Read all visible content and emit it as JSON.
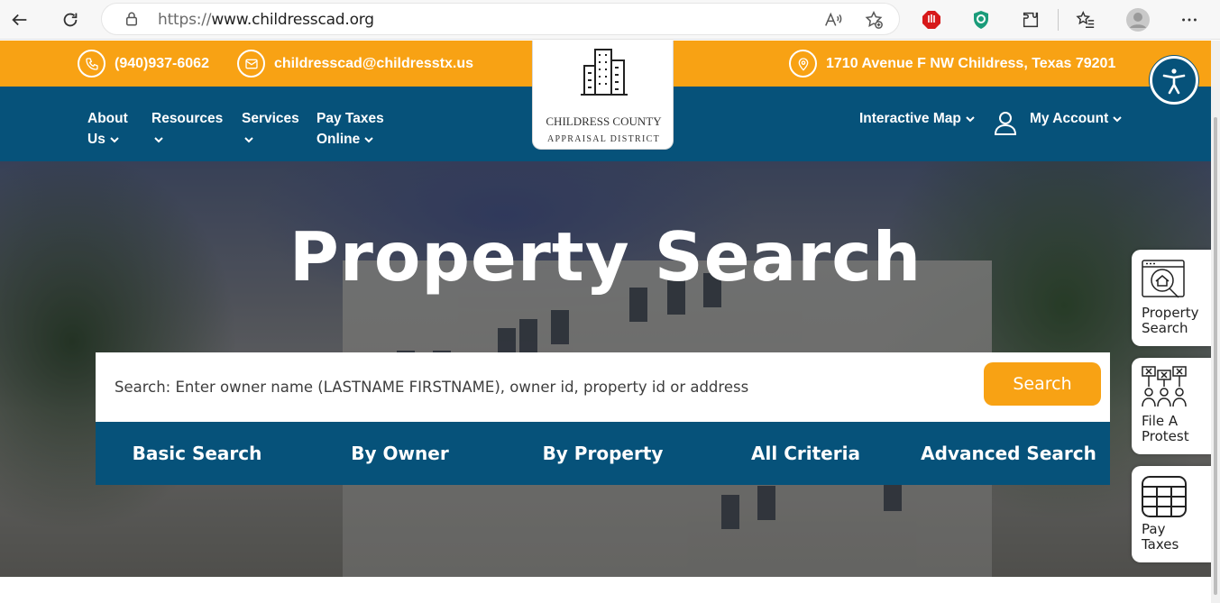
{
  "browser": {
    "url_prefix": "https://",
    "url_domain": "www.childresscad.org",
    "back_icon": "back-arrow-icon",
    "refresh_icon": "refresh-icon"
  },
  "topbar": {
    "phone": "(940)937-6062",
    "email": "childresscad@childresstx.us",
    "address": "1710 Avenue F NW Childress, Texas 79201"
  },
  "logo": {
    "line1": "CHILDRESS COUNTY",
    "line2": "APPRAISAL DISTRICT"
  },
  "nav": {
    "about_1": "About",
    "about_2": "Us",
    "resources": "Resources",
    "services": "Services",
    "pay_1": "Pay Taxes",
    "pay_2": "Online",
    "map": "Interactive Map",
    "account": "My Account"
  },
  "hero": {
    "title": "Property Search",
    "search_placeholder": "Search: Enter owner name (LASTNAME FIRSTNAME), owner id, property id or address",
    "search_button": "Search",
    "tabs": [
      "Basic Search",
      "By Owner",
      "By Property",
      "All Criteria",
      "Advanced Search"
    ]
  },
  "side": {
    "property_1": "Property",
    "property_2": "Search",
    "protest_1": "File A",
    "protest_2": "Protest",
    "pay_1": "Pay",
    "pay_2": "Taxes"
  },
  "colors": {
    "orange": "#f8a214",
    "navy": "#06527a"
  }
}
